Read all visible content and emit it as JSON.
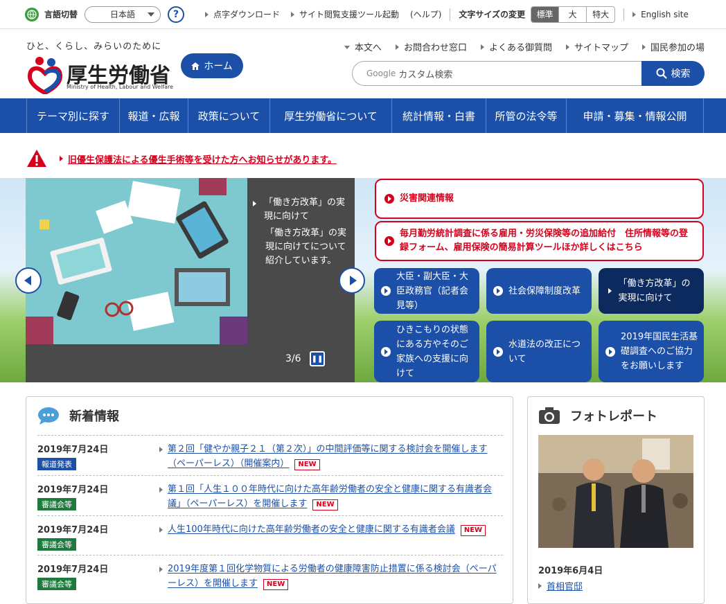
{
  "topbar": {
    "lang_label": "言語切替",
    "lang_value": "日本語",
    "help": "?",
    "links": [
      "点字ダウンロード",
      "サイト閲覧支援ツール起動"
    ],
    "help_text": "(ヘルプ)",
    "fontsize_label": "文字サイズの変更",
    "fontsize_options": [
      "標準",
      "大",
      "特大"
    ],
    "english": "English site"
  },
  "header": {
    "tagline": "ひと、くらし、みらいのために",
    "logo": "厚生労働省",
    "logo_sub": "Ministry of Health, Labour and Welfare",
    "home": "ホーム",
    "links": [
      "本文へ",
      "お問合わせ窓口",
      "よくある御質問",
      "サイトマップ",
      "国民参加の場"
    ],
    "search_placeholder": "カスタム検索",
    "search_brand": "Google",
    "search_btn": "検索"
  },
  "gnav": [
    "テーマ別に探す",
    "報道・広報",
    "政策について",
    "厚生労働省について",
    "統計情報・白書",
    "所管の法令等",
    "申請・募集・情報公開"
  ],
  "alert": "旧優生保護法による優生手術等を受けた方へお知らせがあります。",
  "slider": {
    "caption_title": "「働き方改革」の実現に向けて",
    "caption_body": "「働き方改革」の実現に向けてについて紹介しています。",
    "counter": "3/6"
  },
  "red_links": [
    "災害関連情報",
    "毎月勤労統計調査に係る雇用・労災保険等の追加給付　住所情報等の登録フォーム、雇用保険の簡易計算ツールほか詳しくはこちら"
  ],
  "tiles": [
    "大臣・副大臣・大臣政務官（記者会見等）",
    "社会保障制度改革",
    "「働き方改革」の実現に向けて",
    "ひきこもりの状態にある方やそのご家族への支援に向けて",
    "水道法の改正について",
    "2019年国民生活基礎調査へのご協力をお願いします"
  ],
  "news": {
    "title": "新着情報",
    "items": [
      {
        "date": "2019年7月24日",
        "tag": "報道発表",
        "tag_color": "#1b4fa8",
        "title": "第２回「健やか親子２１（第２次）」の中間評価等に関する検討会を開催します（ペーパーレス）（開催案内）",
        "new": "NEW"
      },
      {
        "date": "2019年7月24日",
        "tag": "審議会等",
        "tag_color": "#1e7a3c",
        "title": "第１回「人生１００年時代に向けた高年齢労働者の安全と健康に関する有識者会議」（ペーパーレス）を開催します",
        "new": "NEW"
      },
      {
        "date": "2019年7月24日",
        "tag": "審議会等",
        "tag_color": "#1e7a3c",
        "title": "人生100年時代に向けた高年齢労働者の安全と健康に関する有識者会議",
        "new": "NEW"
      },
      {
        "date": "2019年7月24日",
        "tag": "審議会等",
        "tag_color": "#1e7a3c",
        "title": "2019年度第１回化学物質による労働者の健康障害防止措置に係る検討会（ペーパーレス）を開催します",
        "new": "NEW"
      }
    ]
  },
  "photo": {
    "title": "フォトレポート",
    "date": "2019年6月4日",
    "link": "首相官邸"
  },
  "colors": {
    "brand": "#1b4fa8",
    "alert": "#d6001c",
    "dark_tile": "#0d2a5e"
  }
}
